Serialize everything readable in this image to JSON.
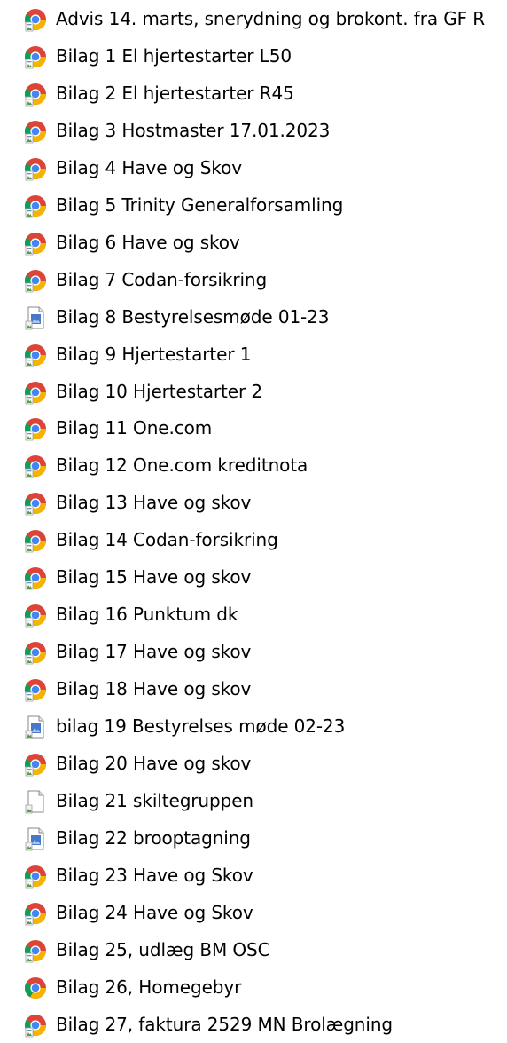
{
  "files": [
    {
      "name": "Advis 14. marts, snerydning og brokont. fra GF R",
      "icon": "chrome-pdf-icon"
    },
    {
      "name": "Bilag 1 El hjertestarter L50",
      "icon": "chrome-pdf-icon"
    },
    {
      "name": "Bilag 2 El hjertestarter R45",
      "icon": "chrome-pdf-icon"
    },
    {
      "name": "Bilag 3 Hostmaster 17.01.2023",
      "icon": "chrome-pdf-icon"
    },
    {
      "name": "Bilag 4 Have og Skov",
      "icon": "chrome-pdf-icon"
    },
    {
      "name": "Bilag 5 Trinity Generalforsamling",
      "icon": "chrome-pdf-icon"
    },
    {
      "name": "Bilag 6 Have og skov",
      "icon": "chrome-pdf-icon"
    },
    {
      "name": "Bilag 7 Codan-forsikring",
      "icon": "chrome-pdf-icon"
    },
    {
      "name": "Bilag 8 Bestyrelsesmøde 01-23",
      "icon": "image-file-icon"
    },
    {
      "name": "Bilag 9 Hjertestarter 1",
      "icon": "chrome-pdf-icon"
    },
    {
      "name": "Bilag 10 Hjertestarter 2",
      "icon": "chrome-pdf-icon"
    },
    {
      "name": "Bilag 11 One.com",
      "icon": "chrome-pdf-icon"
    },
    {
      "name": "Bilag 12 One.com kreditnota",
      "icon": "chrome-pdf-icon"
    },
    {
      "name": "Bilag 13 Have og skov",
      "icon": "chrome-pdf-icon"
    },
    {
      "name": "Bilag 14 Codan-forsikring",
      "icon": "chrome-pdf-icon"
    },
    {
      "name": "Bilag 15 Have og skov",
      "icon": "chrome-pdf-icon"
    },
    {
      "name": "Bilag 16 Punktum dk",
      "icon": "chrome-pdf-icon"
    },
    {
      "name": "Bilag 17 Have og skov",
      "icon": "chrome-pdf-icon"
    },
    {
      "name": "Bilag 18 Have og skov",
      "icon": "chrome-pdf-icon"
    },
    {
      "name": "bilag 19 Bestyrelses møde 02-23",
      "icon": "image-file-icon"
    },
    {
      "name": "Bilag 20 Have og skov",
      "icon": "chrome-pdf-icon"
    },
    {
      "name": "Bilag 21 skiltegruppen",
      "icon": "generic-file-icon"
    },
    {
      "name": "Bilag 22 brooptagning",
      "icon": "image-file-icon"
    },
    {
      "name": "Bilag 23 Have og Skov",
      "icon": "chrome-pdf-icon"
    },
    {
      "name": "Bilag 24 Have og Skov",
      "icon": "chrome-pdf-icon"
    },
    {
      "name": "Bilag 25, udlæg BM OSC",
      "icon": "chrome-pdf-icon"
    },
    {
      "name": "Bilag 26, Homegebyr",
      "icon": "chrome-icon"
    },
    {
      "name": "Bilag 27, faktura 2529 MN Brolægning",
      "icon": "chrome-pdf-icon"
    }
  ]
}
